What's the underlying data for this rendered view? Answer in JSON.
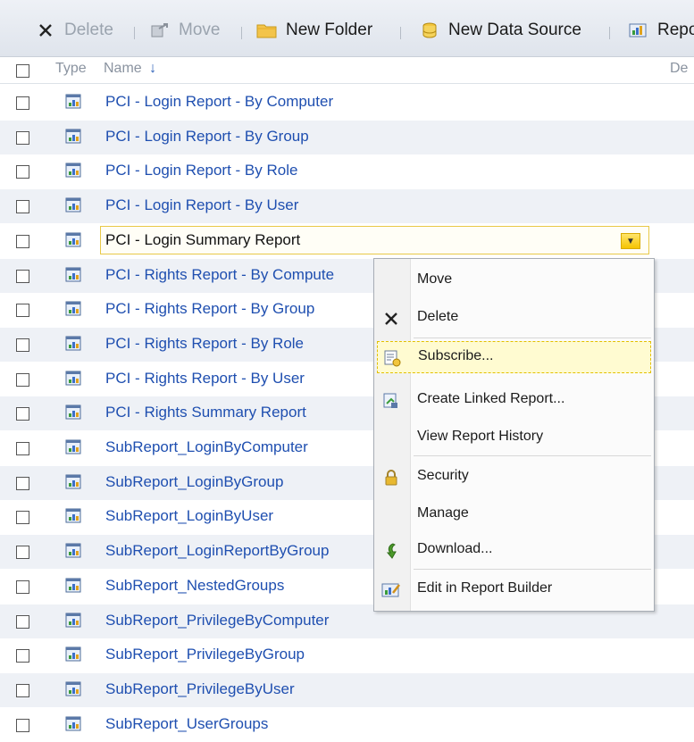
{
  "toolbar": {
    "delete_label": "Delete",
    "move_label": "Move",
    "new_folder_label": "New Folder",
    "new_data_source_label": "New Data Source",
    "report_builder_label": "Repo"
  },
  "header": {
    "type_label": "Type",
    "name_label": "Name",
    "sort_indicator": "↓",
    "description_label": "De"
  },
  "rows": [
    {
      "name": "PCI - Login Report - By Computer"
    },
    {
      "name": "PCI - Login Report - By Group"
    },
    {
      "name": "PCI - Login Report - By Role"
    },
    {
      "name": "PCI - Login Report - By User"
    },
    {
      "name": "PCI - Login Summary Report"
    },
    {
      "name": "PCI - Rights Report - By Compute"
    },
    {
      "name": "PCI - Rights Report - By Group"
    },
    {
      "name": "PCI - Rights Report - By Role"
    },
    {
      "name": "PCI - Rights Report - By User"
    },
    {
      "name": "PCI - Rights Summary Report"
    },
    {
      "name": "SubReport_LoginByComputer"
    },
    {
      "name": "SubReport_LoginByGroup"
    },
    {
      "name": "SubReport_LoginByUser"
    },
    {
      "name": "SubReport_LoginReportByGroup"
    },
    {
      "name": "SubReport_NestedGroups"
    },
    {
      "name": "SubReport_PrivilegeByComputer"
    },
    {
      "name": "SubReport_PrivilegeByGroup"
    },
    {
      "name": "SubReport_PrivilegeByUser"
    },
    {
      "name": "SubReport_UserGroups"
    }
  ],
  "context_menu": {
    "items": [
      {
        "label": "Move"
      },
      {
        "label": "Delete"
      },
      {
        "label": "Subscribe..."
      },
      {
        "label": "Create Linked Report..."
      },
      {
        "label": "View Report History"
      },
      {
        "label": "Security"
      },
      {
        "label": "Manage"
      },
      {
        "label": "Download..."
      },
      {
        "label": "Edit in Report Builder"
      }
    ]
  },
  "colors": {
    "link": "#1f4fb0",
    "selection_border": "#e8c948",
    "menu_hover": "#fffbd1",
    "row_alt": "#eef1f6"
  }
}
